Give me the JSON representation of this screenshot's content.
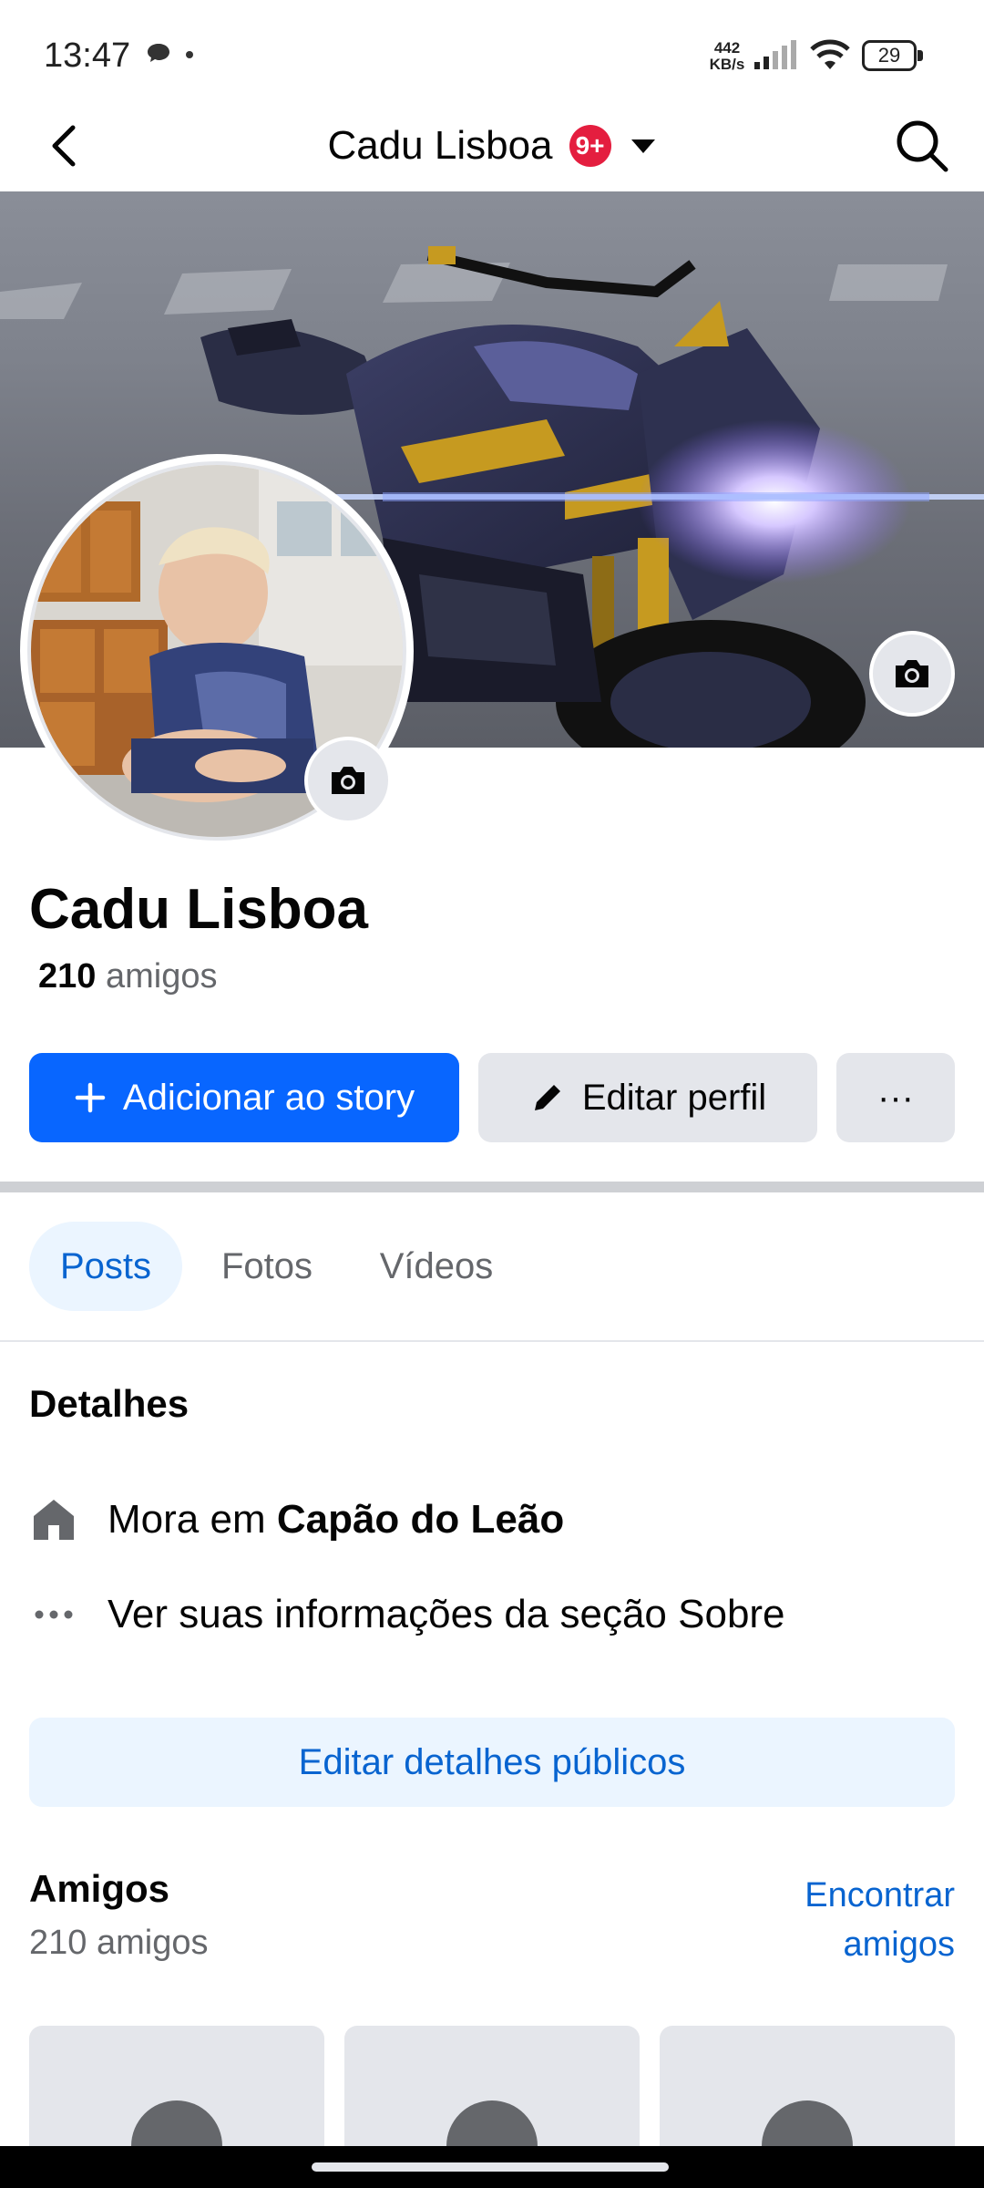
{
  "status_bar": {
    "time": "13:47",
    "speed_value": "442",
    "speed_unit": "KB/s",
    "battery": "29",
    "icons": [
      "message-icon",
      "signal-icon",
      "wifi-icon",
      "battery-icon"
    ]
  },
  "header": {
    "title": "Cadu Lisboa",
    "badge": "9+",
    "icons": [
      "back-arrow-icon",
      "caret-down-icon",
      "search-icon"
    ]
  },
  "profile": {
    "name": "Cadu Lisboa",
    "friends_count": "210",
    "friends_word": "amigos"
  },
  "actions": {
    "add_story": "Adicionar ao story",
    "edit_profile": "Editar perfil",
    "more": "···"
  },
  "tabs": [
    {
      "label": "Posts",
      "selected": true
    },
    {
      "label": "Fotos",
      "selected": false
    },
    {
      "label": "Vídeos",
      "selected": false
    }
  ],
  "details": {
    "title": "Detalhes",
    "lives_prefix": "Mora em ",
    "lives_city": "Capão do Leão",
    "about_link": "Ver suas informações da seção Sobre",
    "edit_public": "Editar detalhes públicos"
  },
  "friends": {
    "title": "Amigos",
    "count_text": "210 amigos",
    "find_line1": "Encontrar",
    "find_line2": "amigos"
  },
  "colors": {
    "primary": "#0866ff",
    "link": "#0864d0",
    "badge": "#e41e3f",
    "secondary_bg": "#e4e6eb",
    "selected_tab_bg": "#ebf5ff"
  }
}
